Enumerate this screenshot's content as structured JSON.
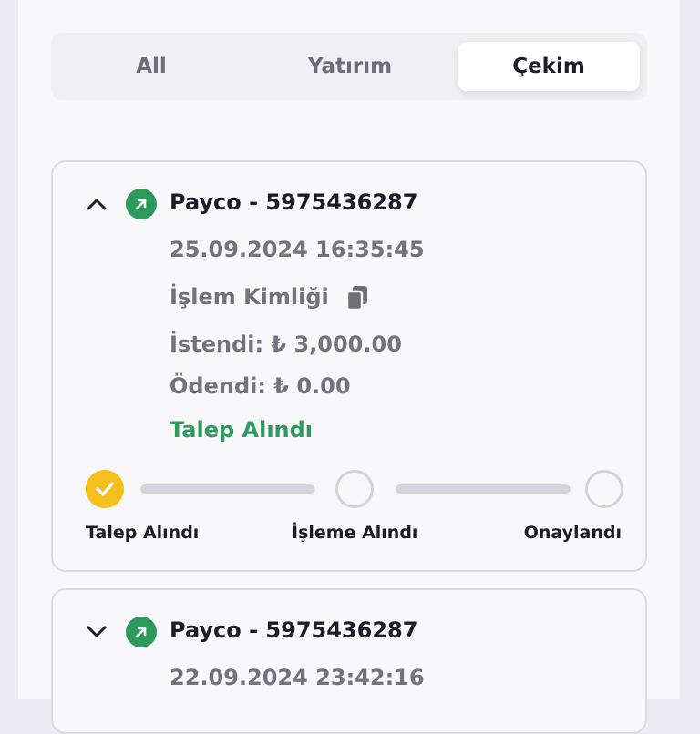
{
  "tabs": [
    {
      "label": "All"
    },
    {
      "label": "Yatırım"
    },
    {
      "label": "Çekim"
    }
  ],
  "active_tab": "Çekim",
  "transactions": [
    {
      "title": "Payco - 5975436287",
      "date": "25.09.2024 16:35:45",
      "transaction_id_label": "İşlem Kimliği",
      "requested": "İstendi: ₺ 3,000.00",
      "paid": "Ödendi: ₺ 0.00",
      "status": "Talep Alındı",
      "expanded": true,
      "steps": [
        {
          "label": "Talep Alındı",
          "done": true
        },
        {
          "label": "İşleme Alındı",
          "done": false
        },
        {
          "label": "Onaylandı",
          "done": false
        }
      ]
    },
    {
      "title": "Payco - 5975436287",
      "date": "22.09.2024 23:42:16",
      "expanded": false
    }
  ],
  "colors": {
    "accent_green": "#2d9a5b",
    "step_done": "#f6bf1c",
    "step_pending": "#d3d2da"
  },
  "icons": {
    "expanded_toggle": "chevron-up-icon",
    "collapsed_toggle": "chevron-down-icon",
    "direction": "arrow-up-right-icon",
    "copy": "copy-icon",
    "step_done": "check-icon"
  }
}
